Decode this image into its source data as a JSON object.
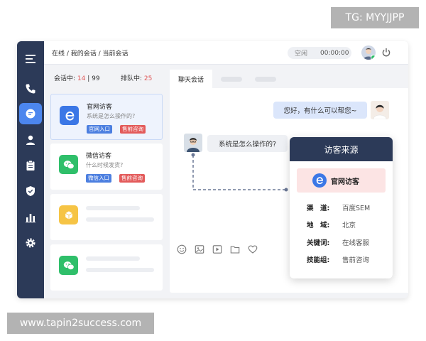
{
  "watermarks": {
    "top": "TG: MYYJJPP",
    "bottom": "www.tapin2success.com"
  },
  "topbar": {
    "breadcrumb": "在线 / 我的会话 / 当前会话",
    "status": "空闲",
    "timer": "00:00:00"
  },
  "queue": {
    "in_session_label": "会话中: ",
    "in_session_count": "14",
    "separator": " | ",
    "in_session_max": "99",
    "queue_label": "排队中: ",
    "queue_count": "25"
  },
  "visitors": [
    {
      "title": "官网访客",
      "message": "系统是怎么操作的?",
      "tags": [
        "官网入口",
        "售前咨询"
      ],
      "icon": "ie-browser-icon",
      "color": "#3b77e6"
    },
    {
      "title": "微信访客",
      "message": "什么时候发货?",
      "tags": [
        "微信入口",
        "售前咨询"
      ],
      "icon": "wechat-icon",
      "color": "#2fbf6a"
    }
  ],
  "placeholder_colors": {
    "third": "#f6c445",
    "fourth": "#2fbf6a"
  },
  "chat": {
    "active_tab": "聊天会话",
    "agent_message": "您好，有什么可以帮您~",
    "visitor_message": "系统是怎么操作的?"
  },
  "source_popup": {
    "title": "访客来源",
    "source": "官网访客",
    "rows": [
      {
        "key": "渠　道:",
        "value": "百度SEM"
      },
      {
        "key": "地　域:",
        "value": "北京"
      },
      {
        "key": "关键词:",
        "value": "在线客服"
      },
      {
        "key": "技能组:",
        "value": "售前咨询"
      }
    ]
  },
  "colors": {
    "sidebar": "#2c3a58",
    "accent": "#4c86ee",
    "tag_blue": "#4c7fe0",
    "tag_red": "#e35b5b"
  }
}
